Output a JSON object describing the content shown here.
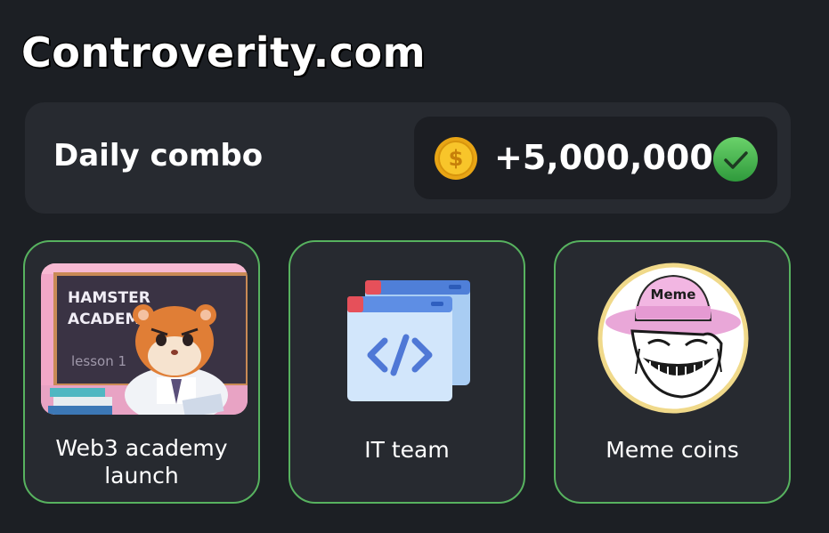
{
  "watermark": "Controverity.com",
  "daily_combo": {
    "title": "Daily combo",
    "reward_value": "+5,000,000",
    "coin_icon": "coin-icon",
    "status_icon": "checkmark-icon"
  },
  "cards": [
    {
      "label": "Web3 academy launch",
      "image_lines": [
        "HAMSTER",
        "ACADEMY",
        "lesson 1"
      ]
    },
    {
      "label": "IT team",
      "icon": "code-window-icon"
    },
    {
      "label": "Meme coins",
      "hat_text": "Meme"
    }
  ],
  "colors": {
    "background": "#1c1f24",
    "panel": "#272a30",
    "accent_green": "#57b25f",
    "coin_gold": "#f5b81c"
  }
}
